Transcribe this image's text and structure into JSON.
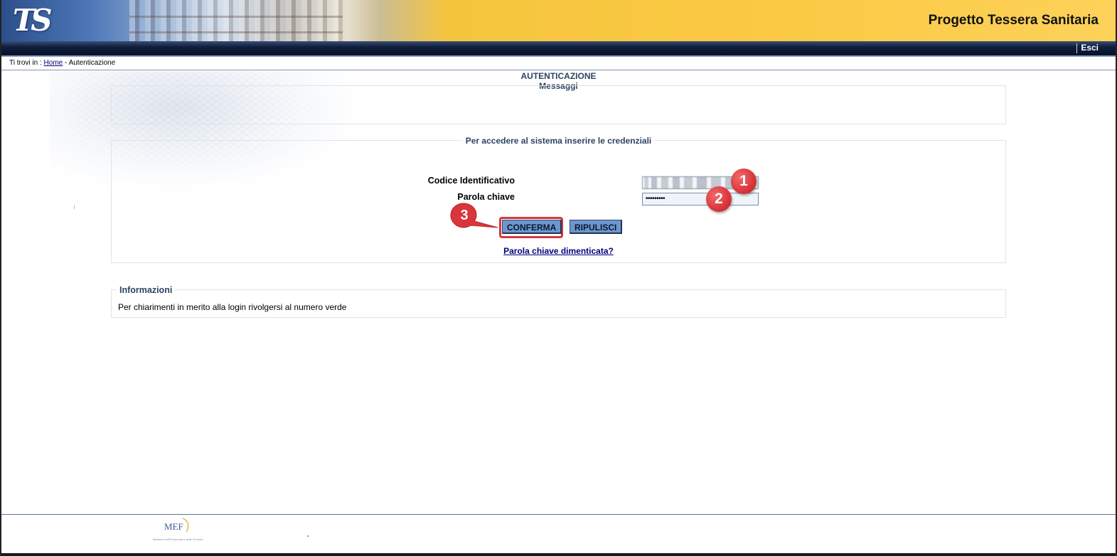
{
  "header": {
    "logo_text": "TS",
    "app_title": "Progetto Tessera Sanitaria",
    "logout_label": "Esci"
  },
  "breadcrumb": {
    "prefix": "Ti trovi in :",
    "home_link": "Home",
    "separator": "-",
    "current": "Autenticazione"
  },
  "page": {
    "heading": "AUTENTICAZIONE",
    "messages_title": "Messaggi",
    "login_title": "Per accedere al sistema inserire le credenziali"
  },
  "form": {
    "user_id_label": "Codice Identificativo",
    "user_id_value": "",
    "password_label": "Parola chiave",
    "password_value": "•••••••••",
    "confirm_label": "CONFERMA",
    "reset_label": "RIPULISCI",
    "forgot_link": "Parola chiave dimenticata?"
  },
  "info": {
    "legend": "Informazioni",
    "text": "Per chiarimenti in merito alla login rivolgersi al numero verde"
  },
  "annotations": [
    {
      "number": "1"
    },
    {
      "number": "2"
    },
    {
      "number": "3"
    }
  ],
  "footer": {
    "logo_text": "MEF",
    "logo_subtitle": "Ministero dell'Economia e delle Finanze"
  },
  "colors": {
    "banner_yellow": "#fbc943",
    "navbar_dark": "#07122a",
    "heading_blue": "#2d4461",
    "button_blue": "#6d97cc",
    "annotation_red": "#d9363b",
    "link_blue": "#00007a"
  }
}
